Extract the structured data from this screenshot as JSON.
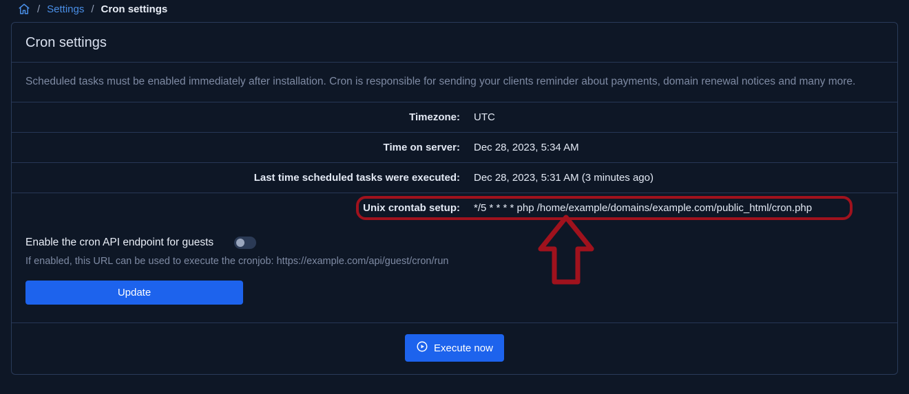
{
  "breadcrumb": {
    "settings": "Settings",
    "current": "Cron settings"
  },
  "card": {
    "title": "Cron settings",
    "description": "Scheduled tasks must be enabled immediately after installation. Cron is responsible for sending your clients reminder about payments, domain renewal notices and many more."
  },
  "rows": {
    "timezone": {
      "label": "Timezone:",
      "value": "UTC"
    },
    "server_time": {
      "label": "Time on server:",
      "value": "Dec 28, 2023, 5:34 AM"
    },
    "last_exec": {
      "label": "Last time scheduled tasks were executed:",
      "value": "Dec 28, 2023, 5:31 AM (3 minutes ago)"
    },
    "crontab": {
      "label": "Unix crontab setup:",
      "value": "*/5 * * * * php /home/example/domains/example.com/public_html/cron.php"
    }
  },
  "settings": {
    "toggle_label": "Enable the cron API endpoint for guests",
    "toggle_on": false,
    "hint": "If enabled, this URL can be used to execute the cronjob: https://example.com/api/guest/cron/run",
    "update_label": "Update"
  },
  "footer": {
    "execute_label": "Execute now"
  }
}
